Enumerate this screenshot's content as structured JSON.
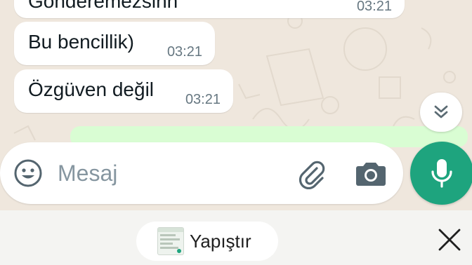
{
  "messages": [
    {
      "text": "Gönderemezsinn",
      "time": "03:21"
    },
    {
      "text": "Bu bencillik)",
      "time": "03:21"
    },
    {
      "text": "Özgüven değil",
      "time": "03:21"
    }
  ],
  "composer": {
    "placeholder": "Mesaj"
  },
  "icons": {
    "emoji": "smiley-icon",
    "attach": "paperclip-icon",
    "camera": "camera-icon",
    "mic": "microphone-icon",
    "scroll_down": "double-chevron-down-icon",
    "close": "close-icon"
  },
  "clipboard": {
    "paste_label": "Yapıştır"
  },
  "colors": {
    "chat_background": "#efe7dd",
    "incoming_bubble": "#ffffff",
    "outgoing_bubble": "#d9fdd3",
    "accent_green": "#1ea47e",
    "timestamp": "#667781",
    "placeholder": "#8696a0"
  }
}
